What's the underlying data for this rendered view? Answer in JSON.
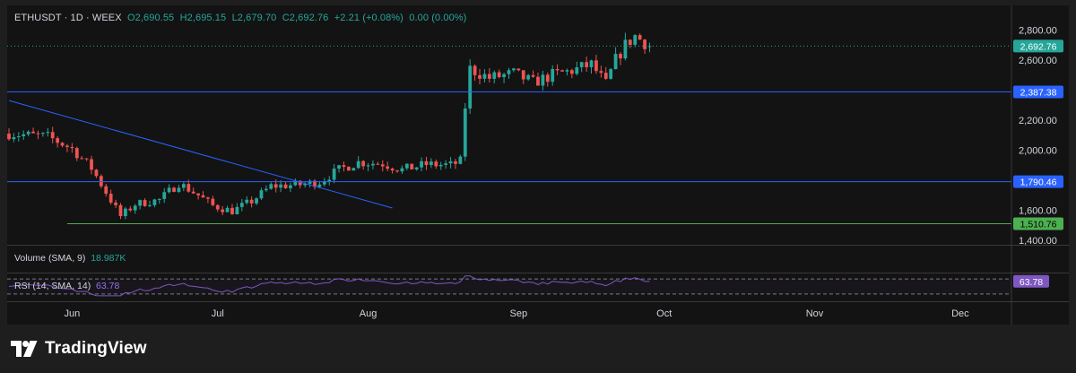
{
  "header": {
    "symbol": "ETHUSDT",
    "interval": "1D",
    "exchange": "WEEX",
    "open": "O2,690.55",
    "high": "H2,695.15",
    "low": "L2,679.70",
    "close": "C2,692.76",
    "change": "+2.21 (+0.08%)",
    "extra": "0.00 (0.00%)"
  },
  "volume_pane": {
    "label": "Volume (SMA, 9)",
    "value": "18.987K"
  },
  "rsi_pane": {
    "label": "RSI (14, SMA, 14)",
    "value": "63.78",
    "badge": "63.78"
  },
  "price_axis": {
    "ticks": [
      "2,800.00",
      "2,600.00",
      "2,200.00",
      "2,000.00",
      "1,600.00",
      "1,400.00"
    ]
  },
  "time_axis": {
    "ticks": [
      "Jun",
      "Jul",
      "Aug",
      "Sep",
      "Oct",
      "Nov",
      "Dec"
    ]
  },
  "badges": {
    "last_price": "2,692.76",
    "level_1": "2,387.38",
    "level_2": "1,790.46",
    "level_3": "1,510.76"
  },
  "branding": {
    "logo_text": "TradingView"
  },
  "colors": {
    "up": "#26a69a",
    "down": "#ef5350",
    "background": "#1e1e1e",
    "panel": "#131313",
    "blue_line": "#2962ff",
    "green_line": "#4caf50",
    "rsi": "#7e57c2"
  },
  "chart_data": {
    "type": "candlestick",
    "symbol": "ETHUSDT",
    "interval": "1D",
    "x_range": [
      "2024-05-19",
      "2024-12-11"
    ],
    "ylim": [
      1400,
      2880
    ],
    "y_ticks": [
      2800,
      2600,
      2200,
      2000,
      1600,
      1400
    ],
    "x_ticks": [
      "2024-06-01",
      "2024-07-01",
      "2024-08-01",
      "2024-09-01",
      "2024-10-01",
      "2024-11-01",
      "2024-12-01"
    ],
    "last_close": 2692.76,
    "horizontal_levels": [
      2387.38,
      1790.46,
      1510.76
    ],
    "trendline": {
      "from": [
        "2024-05-19",
        2330
      ],
      "to": [
        "2024-08-06",
        1615
      ]
    },
    "support_line": {
      "from": [
        "2024-05-31",
        1510.76
      ],
      "to": [
        "2024-12-11",
        1510.76
      ]
    },
    "anchors": [
      [
        "2024-05-19",
        2110
      ],
      [
        "2024-05-27",
        2090
      ],
      [
        "2024-06-01",
        2010
      ],
      [
        "2024-06-05",
        1880
      ],
      [
        "2024-06-08",
        1720
      ],
      [
        "2024-06-11",
        1560
      ],
      [
        "2024-06-14",
        1640
      ],
      [
        "2024-06-19",
        1670
      ],
      [
        "2024-06-23",
        1780
      ],
      [
        "2024-06-27",
        1700
      ],
      [
        "2024-06-30",
        1630
      ],
      [
        "2024-07-04",
        1595
      ],
      [
        "2024-07-08",
        1660
      ],
      [
        "2024-07-12",
        1760
      ],
      [
        "2024-07-18",
        1770
      ],
      [
        "2024-07-22",
        1790
      ],
      [
        "2024-07-26",
        1870
      ],
      [
        "2024-07-30",
        1920
      ],
      [
        "2024-08-04",
        1910
      ],
      [
        "2024-08-08",
        1870
      ],
      [
        "2024-08-13",
        1905
      ],
      [
        "2024-08-18",
        1900
      ],
      [
        "2024-08-20",
        1925
      ],
      [
        "2024-08-21",
        2290
      ],
      [
        "2024-08-22",
        2540
      ],
      [
        "2024-08-26",
        2480
      ],
      [
        "2024-08-31",
        2510
      ],
      [
        "2024-09-04",
        2450
      ],
      [
        "2024-09-08",
        2500
      ],
      [
        "2024-09-12",
        2530
      ],
      [
        "2024-09-16",
        2570
      ],
      [
        "2024-09-19",
        2440
      ],
      [
        "2024-09-21",
        2600
      ],
      [
        "2024-09-23",
        2700
      ],
      [
        "2024-09-25",
        2760
      ],
      [
        "2024-09-28",
        2692.76
      ]
    ],
    "rsi": {
      "value": 63.78,
      "levels": [
        70,
        30
      ]
    },
    "volume_sma_9": "18.987K"
  }
}
